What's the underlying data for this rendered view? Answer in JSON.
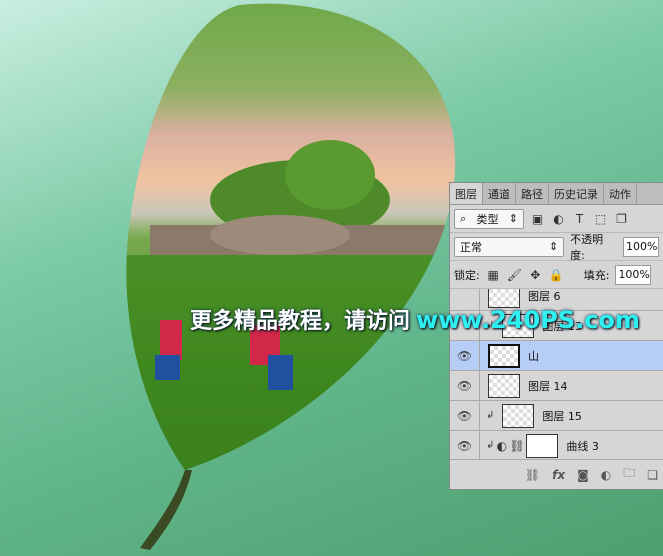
{
  "watermark": {
    "text": "更多精品教程，请访问",
    "url": "www.240PS.com"
  },
  "panel": {
    "tabs": [
      "图层",
      "通道",
      "路径",
      "历史记录",
      "动作"
    ],
    "filter": {
      "label": "类型"
    },
    "blend_mode": "正常",
    "opacity_label": "不透明度:",
    "opacity": "100%",
    "lock_label": "锁定:",
    "fill_label": "填充:",
    "fill": "100%",
    "layers": [
      {
        "name": "图层 6",
        "visible": false
      },
      {
        "name": "图层 13",
        "visible": false,
        "clipped": true
      },
      {
        "name": "山",
        "visible": true,
        "selected": true
      },
      {
        "name": "图层 14",
        "visible": true
      },
      {
        "name": "图层 15",
        "visible": true,
        "clipped": true
      },
      {
        "name": "曲线 3",
        "visible": true,
        "clipped": true
      }
    ]
  }
}
